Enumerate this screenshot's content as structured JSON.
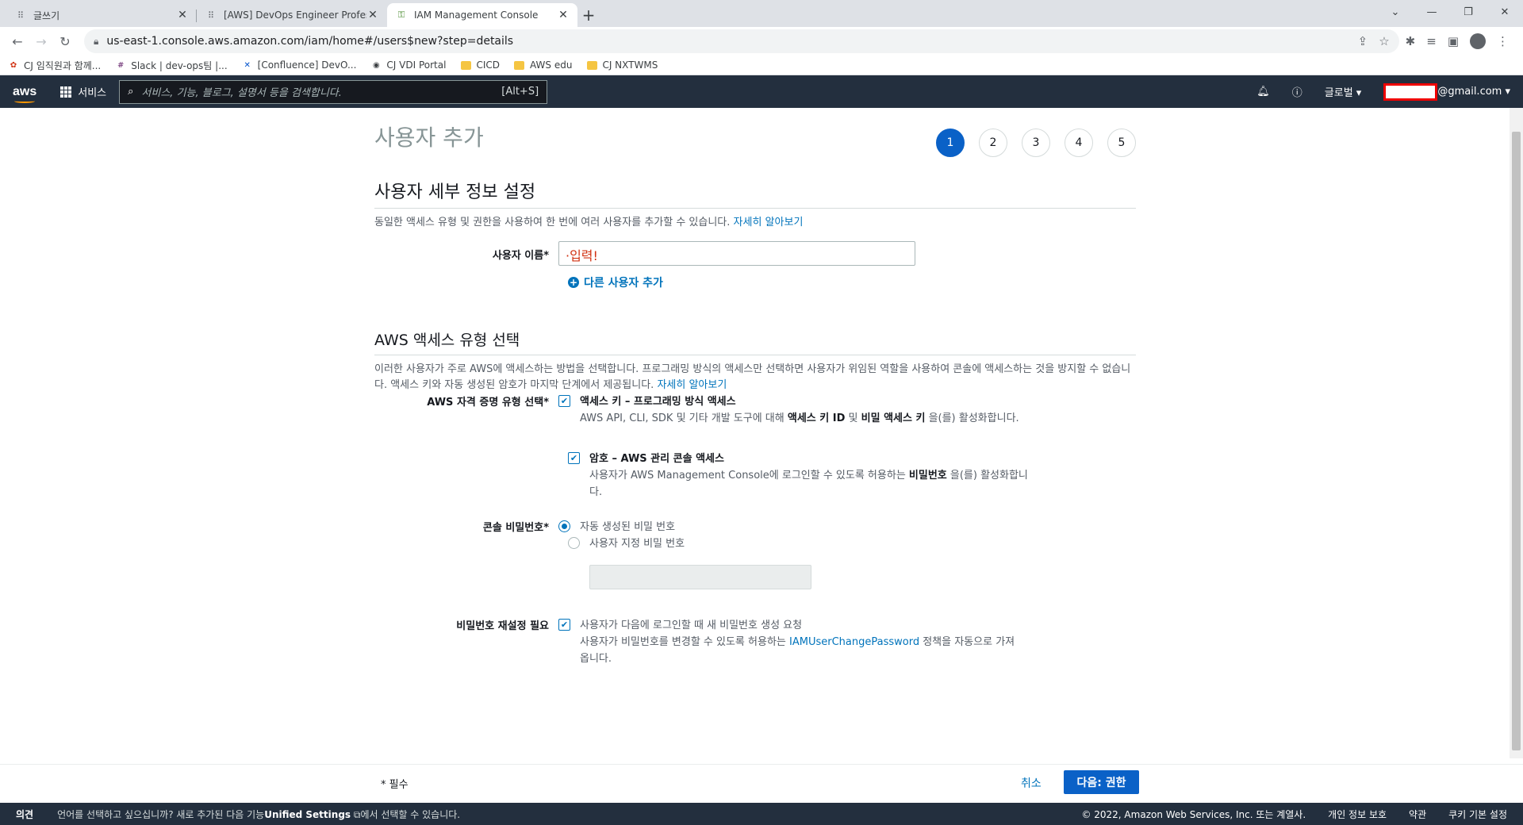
{
  "browser": {
    "tabs": [
      {
        "title": "글쓰기",
        "icon": "tistory-icon",
        "active": false
      },
      {
        "title": "[AWS] DevOps Engineer Profess",
        "icon": "tistory-icon",
        "active": false
      },
      {
        "title": "IAM Management Console",
        "icon": "aws-key-icon",
        "active": true
      }
    ],
    "url": "us-east-1.console.aws.amazon.com/iam/home#/users$new?step=details",
    "bookmarks": [
      {
        "label": "CJ 임직원과 함께...",
        "icon": "cj-icon"
      },
      {
        "label": "Slack | dev-ops팀 |...",
        "icon": "slack-icon"
      },
      {
        "label": "[Confluence] DevO...",
        "icon": "confluence-icon"
      },
      {
        "label": "CJ VDI Portal",
        "icon": "globe-icon"
      },
      {
        "label": "CICD",
        "icon": "folder-icon"
      },
      {
        "label": "AWS edu",
        "icon": "folder-icon"
      },
      {
        "label": "CJ NXTWMS",
        "icon": "folder-icon"
      }
    ]
  },
  "aws_header": {
    "logo": "aws",
    "services_label": "서비스",
    "search_placeholder": "서비스, 기능, 블로그, 설명서 등을 검색합니다.",
    "search_shortcut": "[Alt+S]",
    "region": "글로벌 ▾",
    "account": "@gmail.com ▾"
  },
  "page": {
    "title": "사용자 추가",
    "steps": [
      "1",
      "2",
      "3",
      "4",
      "5"
    ],
    "active_step": 1,
    "section1": {
      "title": "사용자 세부 정보 설정",
      "desc": "동일한 액세스 유형 및 권한을 사용하여 한 번에 여러 사용자를 추가할 수 있습니다.",
      "learn_more": "자세히 알아보기",
      "username_label": "사용자 이름*",
      "username_value": "·입력!",
      "add_user": "다른 사용자 추가"
    },
    "section2": {
      "title": "AWS 액세스 유형 선택",
      "desc": "이러한 사용자가 주로 AWS에 액세스하는 방법을 선택합니다. 프로그래밍 방식의 액세스만 선택하면 사용자가 위임된 역할을 사용하여 콘솔에 액세스하는 것을 방지할 수 없습니다. 액세스 키와 자동 생성된 암호가 마지막 단계에서 제공됩니다.",
      "learn_more": "자세히 알아보기",
      "cred_label": "AWS 자격 증명 유형 선택*",
      "opt1_title": "액세스 키 – 프로그래밍 방식 액세스",
      "opt1_desc_a": "AWS API, CLI, SDK 및 기타 개발 도구에 대해 ",
      "opt1_desc_b": "액세스 키 ID",
      "opt1_desc_c": " 및 ",
      "opt1_desc_d": "비밀 액세스 키",
      "opt1_desc_e": " 을(를) 활성화합니다.",
      "opt2_title": "암호 – AWS 관리 콘솔 액세스",
      "opt2_desc_a": "사용자가 AWS Management Console에 로그인할 수 있도록 허용하는 ",
      "opt2_desc_b": "비밀번호",
      "opt2_desc_c": " 을(를) 활성화합니다.",
      "console_pw_label": "콘솔 비밀번호*",
      "radio1": "자동 생성된 비밀 번호",
      "radio2": "사용자 지정 비밀 번호",
      "reset_label": "비밀번호 재설정 필요",
      "reset_title": "사용자가 다음에 로그인할 때 새 비밀번호 생성 요청",
      "reset_desc_a": "사용자가 비밀번호를 변경할 수 있도록 허용하는 ",
      "reset_desc_link": "IAMUserChangePassword",
      "reset_desc_b": " 정책을 자동으로 가져옵니다."
    },
    "footer": {
      "required": "* 필수",
      "cancel": "취소",
      "next": "다음: 권한"
    }
  },
  "aws_footer": {
    "feedback": "의견",
    "lang_msg_a": "언어를 선택하고 싶으십니까? 새로 추가된 다음 기능",
    "lang_msg_b": "Unified Settings",
    "lang_msg_c": "에서 선택할 수 있습니다.",
    "copyright": "© 2022, Amazon Web Services, Inc. 또는 계열사.",
    "privacy": "개인 정보 보호",
    "terms": "약관",
    "cookies": "쿠키 기본 설정"
  }
}
